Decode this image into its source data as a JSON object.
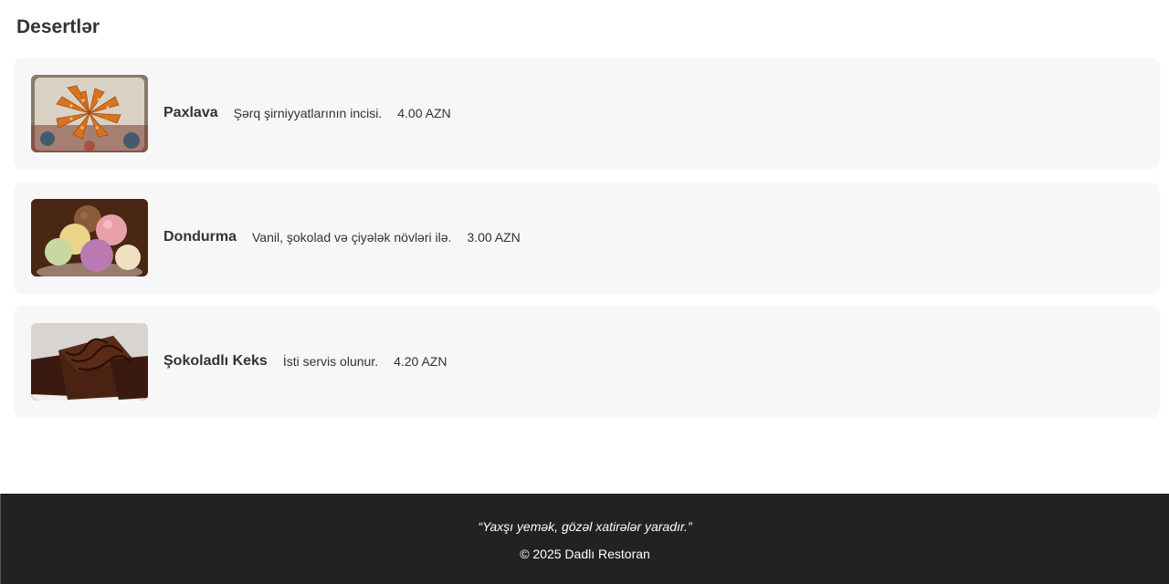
{
  "section": {
    "title": "Desertlər"
  },
  "items": [
    {
      "name": "Paxlava",
      "description": "Şərq şirniyyatlarının incisi.",
      "price": "4.00 AZN",
      "image_icon": "baklava-photo"
    },
    {
      "name": "Dondurma",
      "description": "Vanil, şokolad və çiyələk növləri ilə.",
      "price": "3.00 AZN",
      "image_icon": "ice-cream-photo"
    },
    {
      "name": "Şokoladlı Keks",
      "description": "İsti servis olunur.",
      "price": "4.20 AZN",
      "image_icon": "chocolate-cake-photo"
    }
  ],
  "footer": {
    "quote": "“Yaxşı yemək, gözəl xatirələr yaradır.”",
    "copyright": "© 2025 Dadlı Restoran"
  },
  "colors": {
    "card_background": "#f7f7f7",
    "footer_background": "#222222",
    "text": "#333333"
  }
}
